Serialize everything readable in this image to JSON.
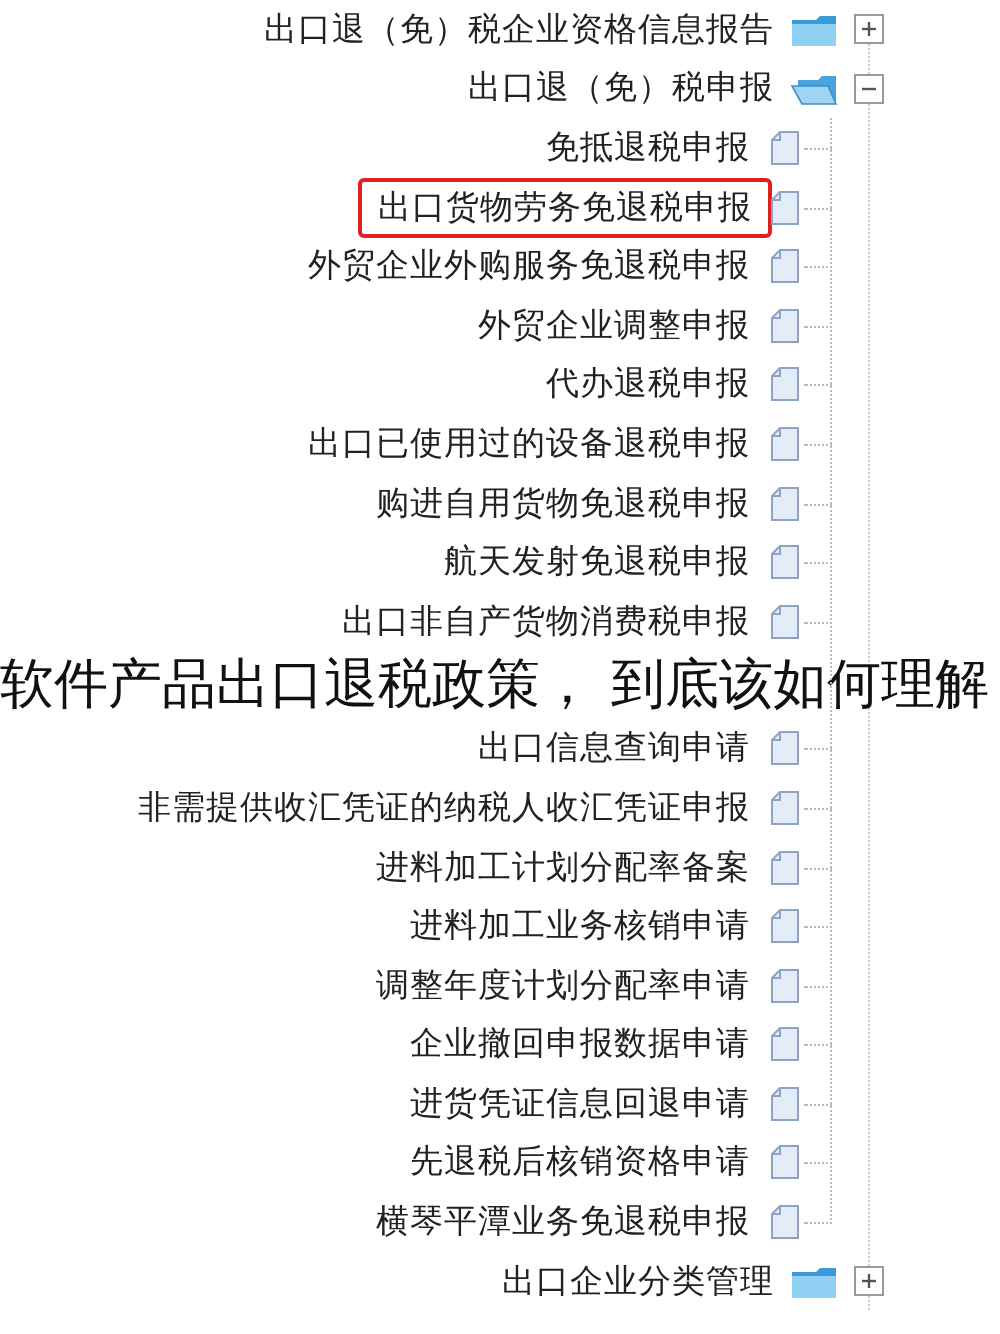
{
  "tree": [
    {
      "label": "出口退（免）税企业资格信息报告",
      "expanded": false
    },
    {
      "label": "出口退（免）税申报",
      "expanded": true,
      "children": [
        {
          "label": "免抵退税申报",
          "selected": false
        },
        {
          "label": "出口货物劳务免退税申报",
          "selected": true
        },
        {
          "label": "外贸企业外购服务免退税申报",
          "selected": false
        },
        {
          "label": "外贸企业调整申报",
          "selected": false
        },
        {
          "label": "代办退税申报",
          "selected": false
        },
        {
          "label": "出口已使用过的设备退税申报",
          "selected": false
        },
        {
          "label": "购进自用货物免退税申报",
          "selected": false
        },
        {
          "label": "航天发射免退税申报",
          "selected": false
        },
        {
          "label": "出口非自产货物消费税申报",
          "selected": false
        },
        {
          "label": "出口信息查询申请",
          "selected": false
        },
        {
          "label": "非需提供收汇凭证的纳税人收汇凭证申报",
          "selected": false
        },
        {
          "label": "进料加工计划分配率备案",
          "selected": false
        },
        {
          "label": "进料加工业务核销申请",
          "selected": false
        },
        {
          "label": "调整年度计划分配率申请",
          "selected": false
        },
        {
          "label": "企业撤回申报数据申请",
          "selected": false
        },
        {
          "label": "进货凭证信息回退申请",
          "selected": false
        },
        {
          "label": "先退税后核销资格申请",
          "selected": false
        },
        {
          "label": "横琴平潭业务免退税申报",
          "selected": false
        }
      ]
    },
    {
      "label": "出口企业分类管理",
      "expanded": false
    }
  ],
  "caption": "软件产品出口退税政策， 到底该如何理解"
}
